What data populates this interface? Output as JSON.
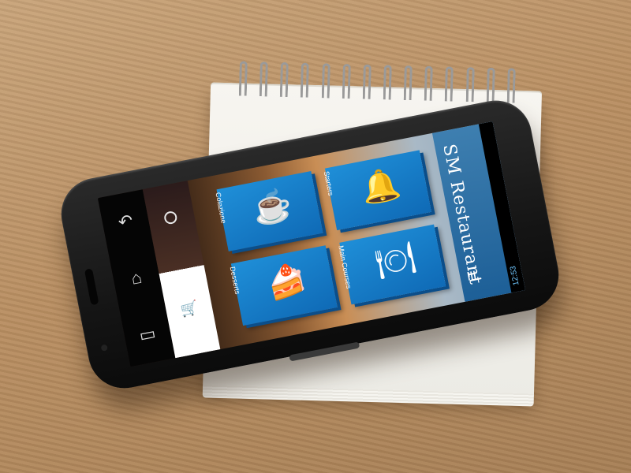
{
  "app": {
    "title": "SM Restaurant",
    "status_time": "12:53"
  },
  "tiles": [
    {
      "label": "Colazione",
      "icon": "cup-icon"
    },
    {
      "label": "Starters",
      "icon": "cloche-icon"
    },
    {
      "label": "Desserts",
      "icon": "cake-icon"
    },
    {
      "label": "Main Courses",
      "icon": "plate-icon"
    }
  ],
  "nav": {
    "back_icon": "back-icon",
    "home_icon": "home-icon",
    "recent_icon": "recent-apps-icon"
  },
  "colors": {
    "tile_blue": "#1f8fd8",
    "tile_shadow": "#0b4e8a",
    "title_panel": "#1d5f97"
  }
}
